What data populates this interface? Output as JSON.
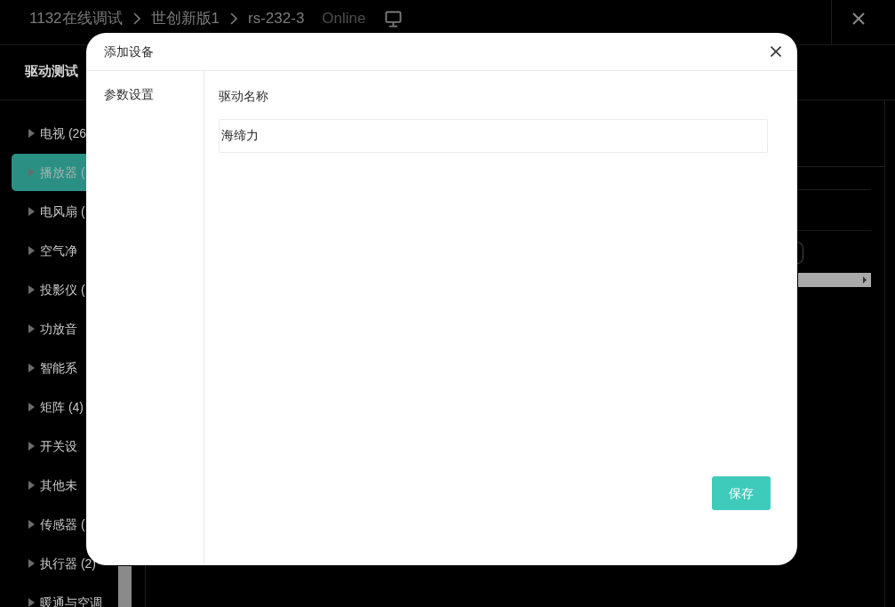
{
  "header": {
    "breadcrumbs": [
      "1132在线调试",
      "世创新版1",
      "rs-232-3"
    ],
    "status": "Online"
  },
  "panel": {
    "title": "驱动测试"
  },
  "sidebar": {
    "items": [
      {
        "label": "电视 (26",
        "selected": false,
        "expanded": false
      },
      {
        "label": "播放器 (",
        "selected": true,
        "expanded": false
      },
      {
        "label": "电风扇 (",
        "selected": false,
        "expanded": false
      },
      {
        "label": "空气净",
        "selected": false,
        "expanded": false
      },
      {
        "label": "投影仪 (",
        "selected": false,
        "expanded": false
      },
      {
        "label": "功放音",
        "selected": false,
        "expanded": false
      },
      {
        "label": "智能系",
        "selected": false,
        "expanded": false
      },
      {
        "label": "矩阵 (4)",
        "selected": false,
        "expanded": false
      },
      {
        "label": "开关设",
        "selected": false,
        "expanded": false
      },
      {
        "label": "其他未",
        "selected": false,
        "expanded": false
      },
      {
        "label": "传感器 (",
        "selected": false,
        "expanded": false
      },
      {
        "label": "执行器 (2)",
        "selected": false,
        "expanded": false
      },
      {
        "label": "暖通与空调",
        "selected": false,
        "expanded": false
      }
    ]
  },
  "dialog": {
    "title": "添加设备",
    "sections": [
      "参数设置"
    ],
    "field": {
      "label": "驱动名称",
      "value": "海缔力"
    },
    "save_button": "保存"
  }
}
